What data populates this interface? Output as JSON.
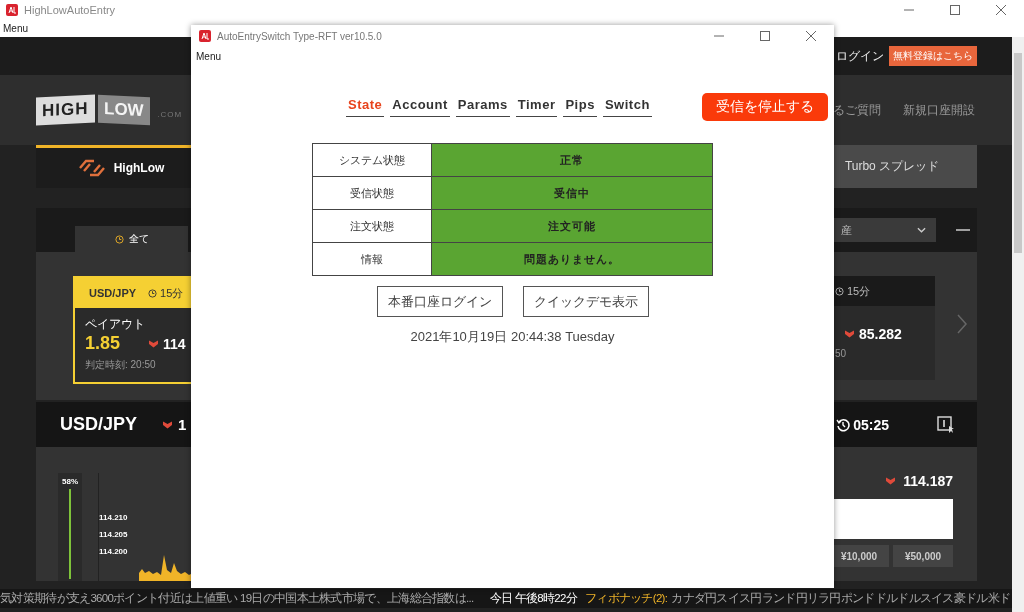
{
  "window": {
    "title": "HighLowAutoEntry",
    "menu": "Menu"
  },
  "site": {
    "logo": {
      "high": "HIGH",
      "low": "LOW",
      "suffix": ".COM"
    },
    "header": {
      "login": "ログイン",
      "signup": "無料登録はこちら"
    },
    "nav": [
      "るご質問",
      "新規口座開設"
    ],
    "product_tabs": [
      {
        "label": "HighLow",
        "selected": true
      },
      {
        "label": "Turbo スプレッド",
        "selected": false
      }
    ],
    "filter": {
      "tab": "全て",
      "asset_select": "産"
    },
    "cards": [
      {
        "pair": "USD/JPY",
        "duration": "15分",
        "selected": true,
        "payout_label": "ペイアウト",
        "payout": "1.85",
        "rate": "114",
        "close_time": "判定時刻: 20:50"
      },
      {
        "duration": "15分",
        "selected": false,
        "rate": "85.282",
        "close_time": "50"
      }
    ],
    "asset_bar": {
      "pair": "USD/JPY",
      "rate": "1",
      "countdown": "05:25"
    },
    "chart": {
      "sentiment": "58%",
      "y_labels": [
        "114.210",
        "114.205",
        "114.200"
      ]
    },
    "trade": {
      "rate": "114.187",
      "amounts": [
        "¥10,000",
        "¥50,000"
      ]
    },
    "ticker": {
      "news": "気対策期待が支え3600ポイント付近は上値重い 19日の中国本土株式市場で、上海総合指数は...",
      "time": "今日 午後8時22分",
      "alert_label": "フィボナッチ(2):",
      "alert_text": "カナダ円スイス円ランド円リラ円ポンドドルドルスイス豪ドル米ド"
    }
  },
  "dialog": {
    "title": "AutoEntrySwitch Type-RFT ver10.5.0",
    "menu": "Menu",
    "tabs": [
      {
        "label": "State",
        "selected": true
      },
      {
        "label": "Account",
        "selected": false
      },
      {
        "label": "Params",
        "selected": false
      },
      {
        "label": "Timer",
        "selected": false
      },
      {
        "label": "Pips",
        "selected": false
      },
      {
        "label": "Switch",
        "selected": false
      }
    ],
    "stop_button": "受信を停止する",
    "status": [
      {
        "label": "システム状態",
        "value": "正常",
        "ok": true
      },
      {
        "label": "受信状態",
        "value": "受信中",
        "ok": true
      },
      {
        "label": "注文状態",
        "value": "注文可能",
        "ok": true
      },
      {
        "label": "情報",
        "value": "問題ありません。",
        "ok": true
      }
    ],
    "buttons": [
      "本番口座ログイン",
      "クイックデモ表示"
    ],
    "datetime": "2021年10月19日 20:44:38 Tuesday"
  }
}
